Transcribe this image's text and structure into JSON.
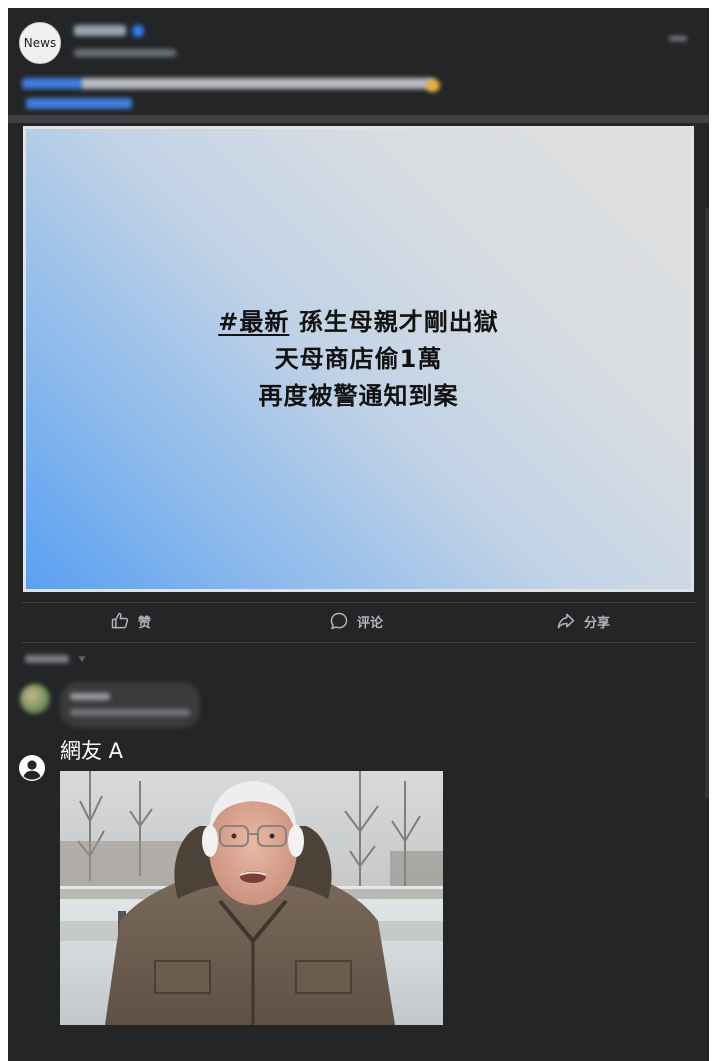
{
  "post": {
    "page_avatar_text": "News",
    "card_lines": {
      "hashtag": "#最新",
      "line1_rest": "孫生母親才剛出獄",
      "line2": "天母商店偷1萬",
      "line3": "再度被警通知到案"
    },
    "card_colors": {
      "gradient_start": "#5aa0f2",
      "gradient_end": "#dedede"
    }
  },
  "actions": {
    "like_label": "赞",
    "comment_label": "评论",
    "share_label": "分享"
  },
  "comment": {
    "user_name": "網友 A"
  },
  "colors": {
    "background": "#242526",
    "action_text": "#b0b3b8",
    "comment_name": "#ffffff"
  }
}
